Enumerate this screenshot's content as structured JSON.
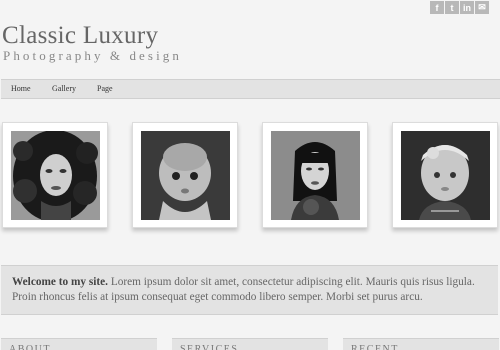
{
  "header": {
    "title": "Classic Luxury",
    "tagline": "Photography & design"
  },
  "social": [
    {
      "label": "f",
      "icon": "facebook-icon"
    },
    {
      "label": "t",
      "icon": "twitter-icon"
    },
    {
      "label": "in",
      "icon": "linkedin-icon"
    },
    {
      "label": "✉",
      "icon": "mail-icon"
    }
  ],
  "nav": {
    "items": [
      "Home",
      "Gallery",
      "Page"
    ]
  },
  "gallery": {
    "photos": [
      "portrait-woman-curly-hair",
      "portrait-baby",
      "portrait-woman-bangs",
      "portrait-child-headband"
    ]
  },
  "welcome": {
    "lead": "Welcome to my site.",
    "text": " Lorem ipsum dolor sit amet, consectetur adipiscing elit. Mauris quis risus ligula. Proin rhoncus felis at ipsum consequat eget commodo libero semper. Morbi set purus arcu."
  },
  "widgets": [
    "ABOUT",
    "SERVICES",
    "RECENT"
  ]
}
